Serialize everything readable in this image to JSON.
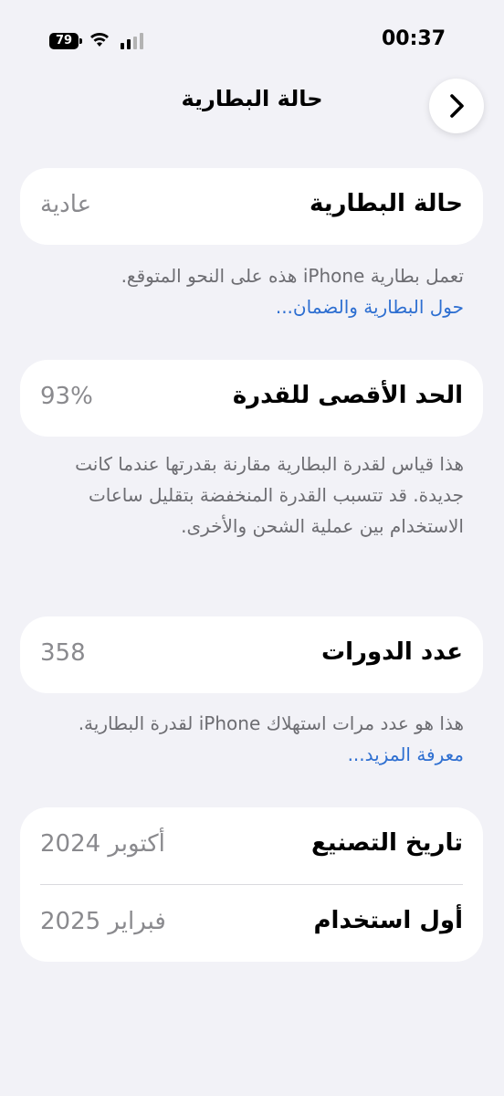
{
  "status_bar": {
    "time": "00:37",
    "battery_level": "79",
    "icons": [
      "battery-icon",
      "wifi-icon",
      "cellular-signal-icon"
    ]
  },
  "nav": {
    "title": "حالة البطارية",
    "back_icon": "chevron-right-icon"
  },
  "battery_health": {
    "label": "حالة البطارية",
    "value": "عادية",
    "footnote": "تعمل بطارية iPhone هذه على النحو المتوقع.",
    "link": "حول البطارية والضمان..."
  },
  "maximum_capacity": {
    "label": "الحد الأقصى للقدرة",
    "value": "93%",
    "footnote": "هذا قياس لقدرة البطارية مقارنة بقدرتها عندما كانت جديدة. قد تتسبب القدرة المنخفضة بتقليل ساعات الاستخدام بين عملية الشحن والأخرى."
  },
  "cycle_count": {
    "label": "عدد الدورات",
    "value": "358",
    "footnote": "هذا هو عدد مرات استهلاك iPhone لقدرة البطارية.",
    "link": "معرفة المزيد..."
  },
  "dates": {
    "manufacture_label": "تاريخ التصنيع",
    "manufacture_value": "أكتوبر 2024",
    "first_use_label": "أول استخدام",
    "first_use_value": "فبراير 2025"
  },
  "colors": {
    "background": "#f2f2f7",
    "card": "#ffffff",
    "link": "#2e6fd1",
    "secondary_text": "#8a8a8e"
  }
}
